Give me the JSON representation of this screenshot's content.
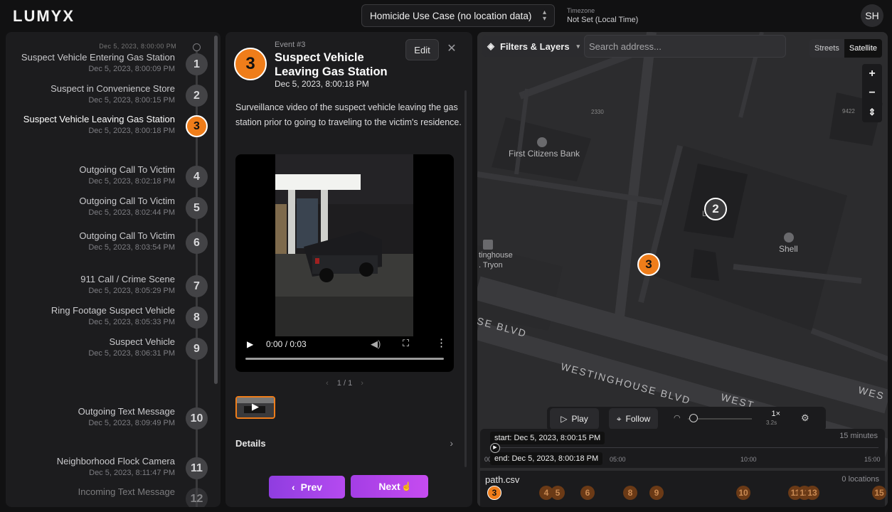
{
  "app": {
    "logo": "LUMYX"
  },
  "header": {
    "case_name": "Homicide Use Case (no location data)",
    "timezone_label": "Timezone",
    "timezone_value": "Not Set (Local Time)",
    "avatar_initials": "SH"
  },
  "timeline": {
    "top_time": "Dec 5, 2023, 8:00:00 PM",
    "items": [
      {
        "num": "1",
        "title": "Suspect Vehicle Entering Gas Station",
        "date": "Dec 5, 2023, 8:00:09 PM"
      },
      {
        "num": "2",
        "title": "Suspect in Convenience Store",
        "date": "Dec 5, 2023, 8:00:15 PM"
      },
      {
        "num": "3",
        "title": "Suspect Vehicle Leaving Gas Station",
        "date": "Dec 5, 2023, 8:00:18 PM"
      },
      {
        "num": "4",
        "title": "Outgoing Call To Victim",
        "date": "Dec 5, 2023, 8:02:18 PM"
      },
      {
        "num": "5",
        "title": "Outgoing Call To Victim",
        "date": "Dec 5, 2023, 8:02:44 PM"
      },
      {
        "num": "6",
        "title": "Outgoing Call To Victim",
        "date": "Dec 5, 2023, 8:03:54 PM"
      },
      {
        "num": "7",
        "title": "911 Call / Crime Scene",
        "date": "Dec 5, 2023, 8:05:29 PM"
      },
      {
        "num": "8",
        "title": "Ring Footage Suspect Vehicle",
        "date": "Dec 5, 2023, 8:05:33 PM"
      },
      {
        "num": "9",
        "title": "Suspect Vehicle",
        "date": "Dec 5, 2023, 8:06:31 PM"
      },
      {
        "num": "10",
        "title": "Outgoing Text Message",
        "date": "Dec 5, 2023, 8:09:49 PM"
      },
      {
        "num": "11",
        "title": "Neighborhood Flock Camera",
        "date": "Dec 5, 2023, 8:11:47 PM"
      },
      {
        "num": "12",
        "title": "Incoming Text Message",
        "date": ""
      }
    ]
  },
  "event": {
    "label": "Event #3",
    "number": "3",
    "title": "Suspect Vehicle Leaving Gas Station",
    "date": "Dec 5, 2023, 8:00:18 PM",
    "edit_label": "Edit",
    "close_icon": "✕",
    "description": "Surveillance video of the suspect vehicle leaving the gas station prior to going to traveling to the victim's residence.",
    "video_time": "0:00 / 0:03",
    "pager": "1 / 1",
    "pager_prev": "‹",
    "pager_next": "›",
    "details_label": "Details",
    "prev_label": "Prev",
    "next_label": "Next"
  },
  "map": {
    "filters_label": "Filters & Layers",
    "search_placeholder": "Search address...",
    "mode_streets": "Streets",
    "mode_satellite": "Satellite",
    "zoom_in": "+",
    "zoom_out": "−",
    "compass": "⇕",
    "labels": {
      "bank": "First Citizens Bank",
      "shell": "Shell",
      "westinghouse_left": "tinghouse",
      "tryon": ". Tryon",
      "street1": "WESTINGHOUSE BLVD",
      "street2": "SE BLVD",
      "street3": "WEST",
      "street4": "WES",
      "n2330": "2330",
      "n9422": "9422",
      "blk_partial": "L   k"
    },
    "marker_2": "2",
    "marker_3": "3"
  },
  "playback": {
    "play_label": "Play",
    "follow_label": "Follow",
    "rate": "1×",
    "rate_sub": "3.2s"
  },
  "timebar": {
    "start": "start: Dec 5, 2023, 8:00:15 PM",
    "end": "end: Dec 5, 2023, 8:00:18 PM",
    "range": "15 minutes",
    "ticks": [
      "00",
      "05:00",
      "10:00",
      "15:00"
    ]
  },
  "path": {
    "name": "path.csv",
    "count": "0 locations",
    "markers": [
      "3",
      "4",
      "5",
      "6",
      "8",
      "9",
      "10",
      "11",
      "12",
      "13",
      "15"
    ]
  },
  "colors": {
    "accent": "#ef7d1a",
    "button_gradient": "#a43ee5"
  }
}
